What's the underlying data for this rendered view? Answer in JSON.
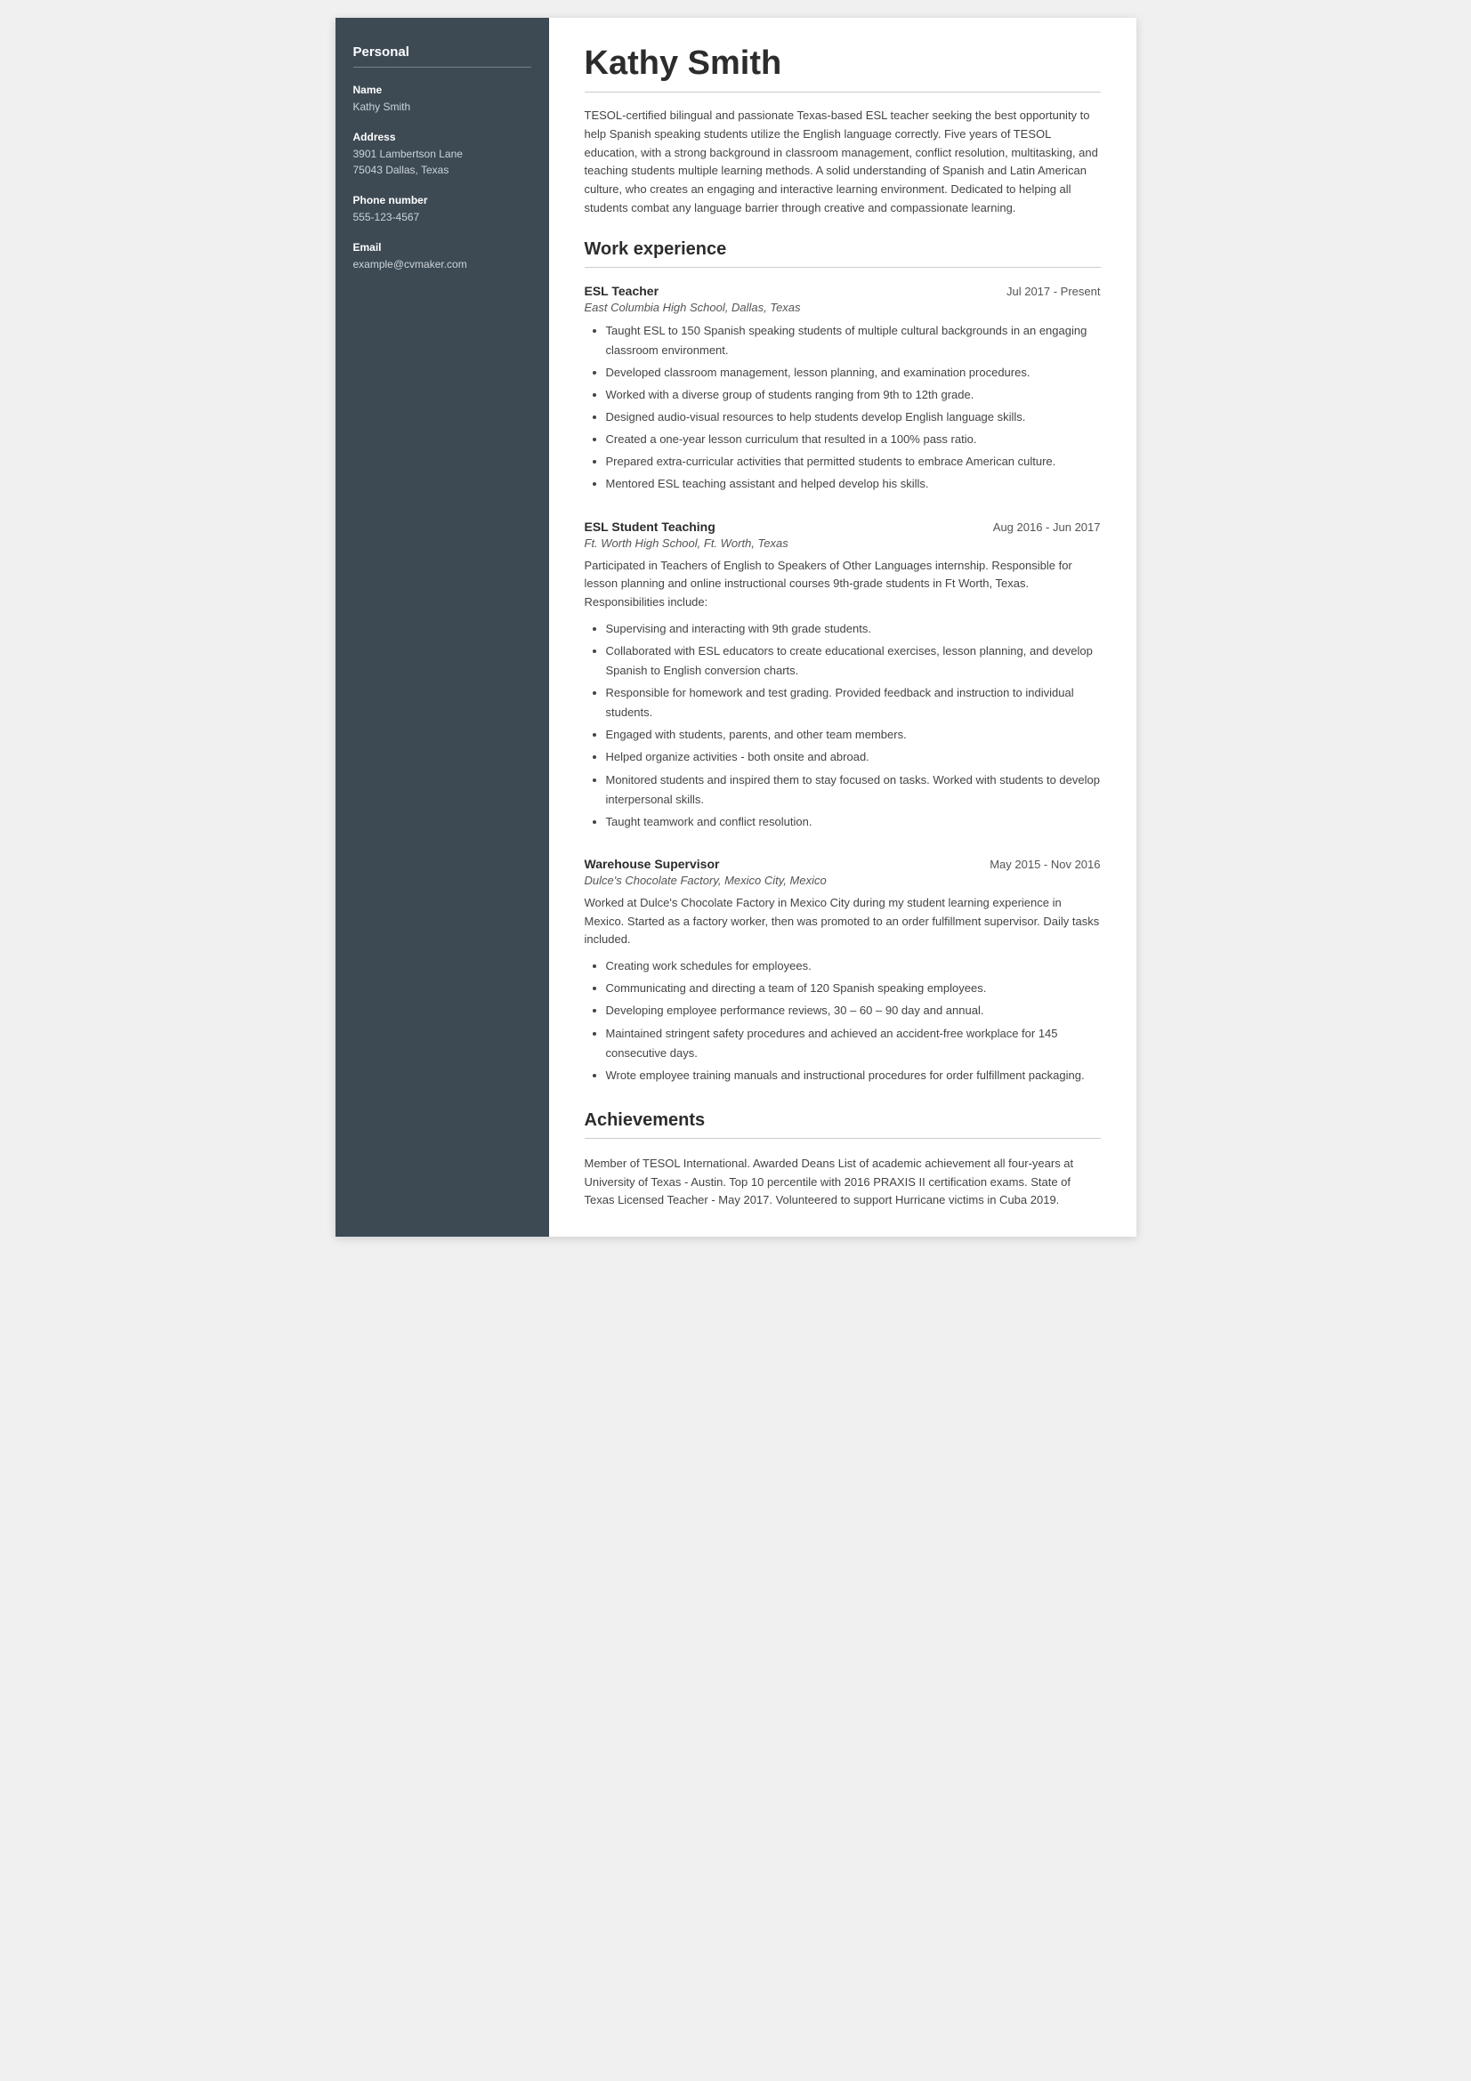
{
  "sidebar": {
    "section_title": "Personal",
    "fields": [
      {
        "label": "Name",
        "value": "Kathy Smith"
      },
      {
        "label": "Address",
        "value": "3901 Lambertson Lane\n75043 Dallas, Texas"
      },
      {
        "label": "Phone number",
        "value": "555-123-4567"
      },
      {
        "label": "Email",
        "value": "example@cvmaker.com"
      }
    ]
  },
  "main": {
    "name": "Kathy Smith",
    "summary": "TESOL-certified bilingual and passionate Texas-based ESL teacher seeking the best opportunity to help Spanish speaking students utilize the English language correctly. Five years of TESOL education, with a strong background in classroom management, conflict resolution, multitasking, and teaching students multiple learning methods. A solid understanding of Spanish and Latin American culture, who creates an engaging and interactive learning environment. Dedicated to helping all students combat any language barrier through creative and compassionate learning.",
    "work_experience_title": "Work experience",
    "jobs": [
      {
        "title": "ESL Teacher",
        "dates": "Jul 2017 - Present",
        "company": "East Columbia High School, Dallas, Texas",
        "description": "",
        "bullets": [
          "Taught ESL to 150 Spanish speaking students of multiple cultural backgrounds in an engaging classroom environment.",
          "Developed classroom management, lesson planning, and examination procedures.",
          "Worked with a diverse group of students ranging from 9th to 12th grade.",
          "Designed audio-visual resources to help students develop English language skills.",
          "Created a one-year lesson curriculum that resulted in a 100% pass ratio.",
          "Prepared extra-curricular activities that permitted students to embrace American culture.",
          "Mentored ESL teaching assistant and helped develop his skills."
        ]
      },
      {
        "title": "ESL Student Teaching",
        "dates": "Aug 2016 - Jun 2017",
        "company": "Ft. Worth High School, Ft. Worth, Texas",
        "description": "Participated in Teachers of English to Speakers of Other Languages internship. Responsible for lesson planning and online instructional courses 9th-grade students in Ft Worth, Texas. Responsibilities include:",
        "bullets": [
          "Supervising and interacting with 9th grade students.",
          "Collaborated with ESL educators to create educational exercises, lesson planning, and develop Spanish to English conversion charts.",
          "Responsible for homework and test grading. Provided feedback and instruction to individual students.",
          "Engaged with students, parents, and other team members.",
          "Helped organize activities - both onsite and abroad.",
          "Monitored students and inspired them to stay focused on tasks. Worked with students to develop interpersonal skills.",
          "Taught teamwork and conflict resolution."
        ]
      },
      {
        "title": "Warehouse Supervisor",
        "dates": "May 2015 - Nov 2016",
        "company": "Dulce's Chocolate Factory, Mexico City, Mexico",
        "description": "Worked at Dulce's Chocolate Factory in Mexico City during my student learning experience in Mexico. Started as a factory worker, then was promoted to an order fulfillment supervisor. Daily tasks included.",
        "bullets": [
          "Creating work schedules for employees.",
          "Communicating and directing a team of 120 Spanish speaking employees.",
          "Developing employee performance reviews, 30 – 60 – 90 day and annual.",
          "Maintained stringent safety procedures and achieved an accident-free workplace for 145 consecutive days.",
          "Wrote employee training manuals and instructional procedures for order fulfillment packaging."
        ]
      }
    ],
    "achievements_title": "Achievements",
    "achievements_text": "Member of TESOL International. Awarded Deans List of academic achievement all four-years at University of Texas - Austin. Top 10 percentile with 2016 PRAXIS II certification exams. State of Texas Licensed Teacher - May 2017. Volunteered to support Hurricane victims in Cuba 2019."
  }
}
